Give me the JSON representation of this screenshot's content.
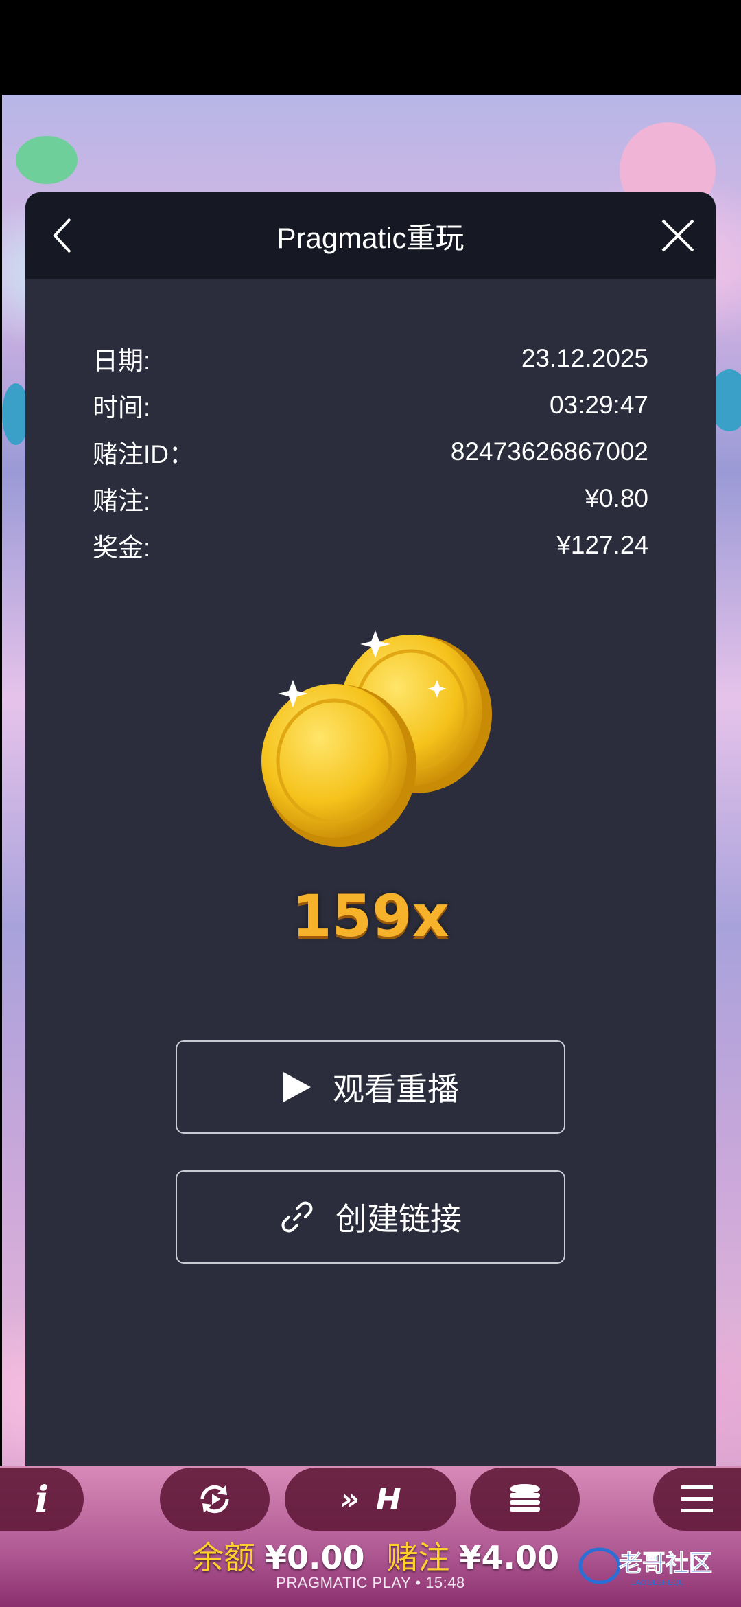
{
  "modal": {
    "title": "Pragmatic重玩",
    "rows": [
      {
        "label": "日期:",
        "value": "23.12.2025"
      },
      {
        "label": "时间:",
        "value": "03:29:47"
      },
      {
        "label": "赌注ID：",
        "value": "82473626867002"
      },
      {
        "label": "赌注:",
        "value": "¥0.80"
      },
      {
        "label": "奖金:",
        "value": "¥127.24"
      }
    ],
    "multiplier": "159x",
    "watch_replay": "观看重播",
    "create_link": "创建链接"
  },
  "controls": {
    "info_label": "i",
    "speed_fast": "»",
    "speed_turbo": "H"
  },
  "footer": {
    "balance_label": "余额",
    "balance_value": "¥0.00",
    "bet_label": "赌注",
    "bet_value": "¥4.00",
    "brand": "PRAGMATIC PLAY • 15:48"
  },
  "watermark": {
    "text": "老哥社区",
    "subtext": "LAOGESHEQU"
  },
  "colors": {
    "modal_bg": "#2b2d3c",
    "header_bg": "#161824",
    "multiplier": "#f6b22b",
    "balance_label": "#ffcf2e"
  }
}
